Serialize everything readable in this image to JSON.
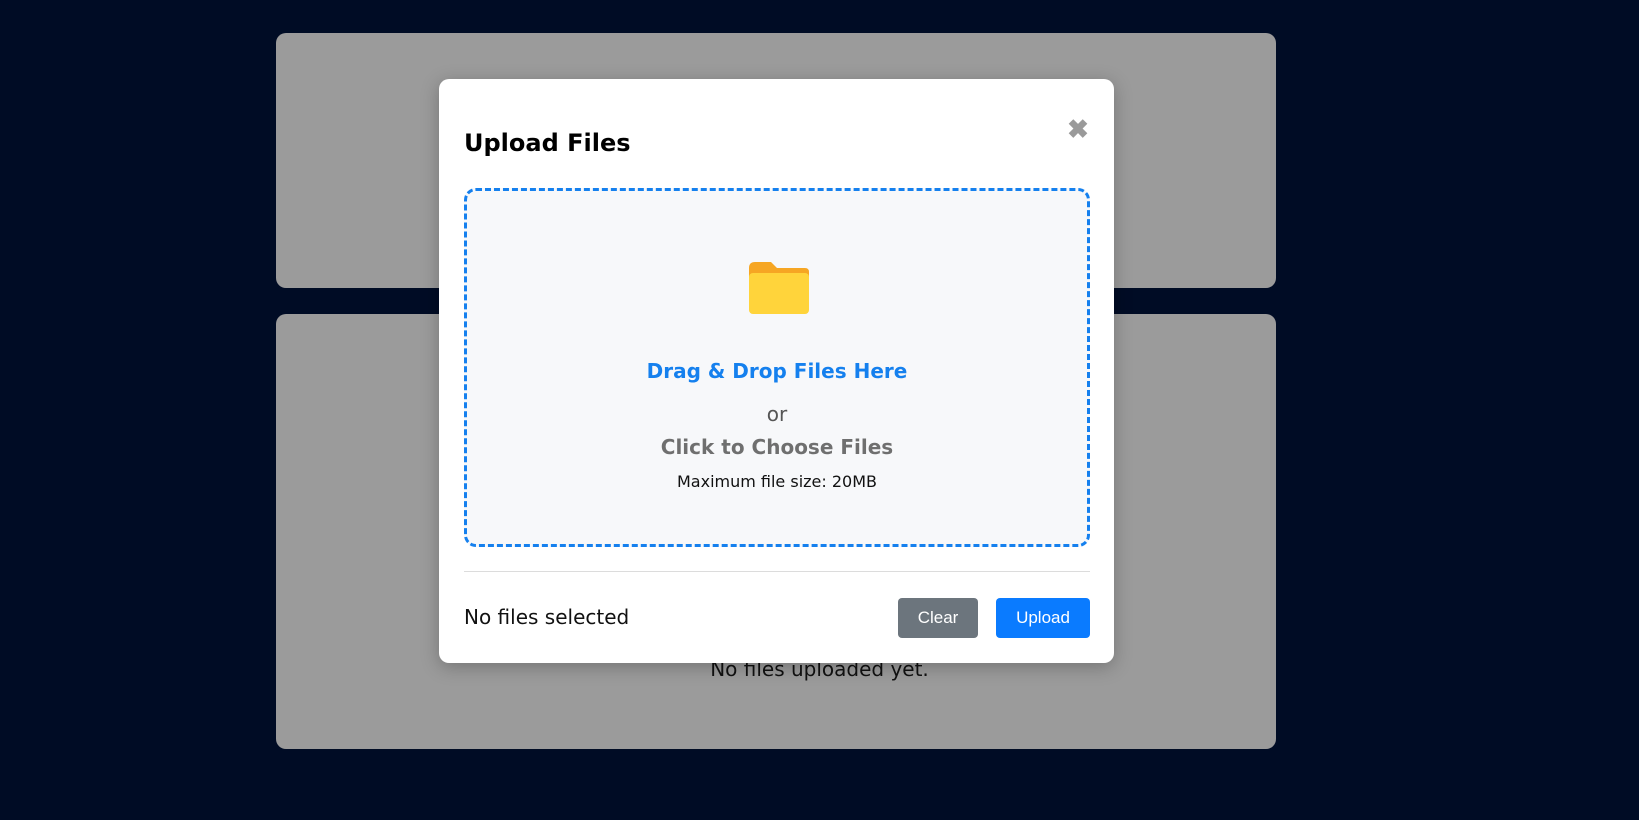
{
  "background": {
    "empty_message": "No files uploaded yet."
  },
  "modal": {
    "title": "Upload Files",
    "close_symbol": "✖",
    "dropzone": {
      "icon": "folder-icon",
      "drag_text": "Drag & Drop Files Here",
      "or_text": "or",
      "choose_text": "Click to Choose Files",
      "max_size_text": "Maximum file size: 20MB"
    },
    "status_text": "No files selected",
    "clear_label": "Clear",
    "upload_label": "Upload"
  },
  "colors": {
    "page_background": "#000c25",
    "accent": "#1580ee",
    "upload_button": "#0a7bff",
    "clear_button": "#6c757d",
    "folder": "#ffd43b"
  }
}
